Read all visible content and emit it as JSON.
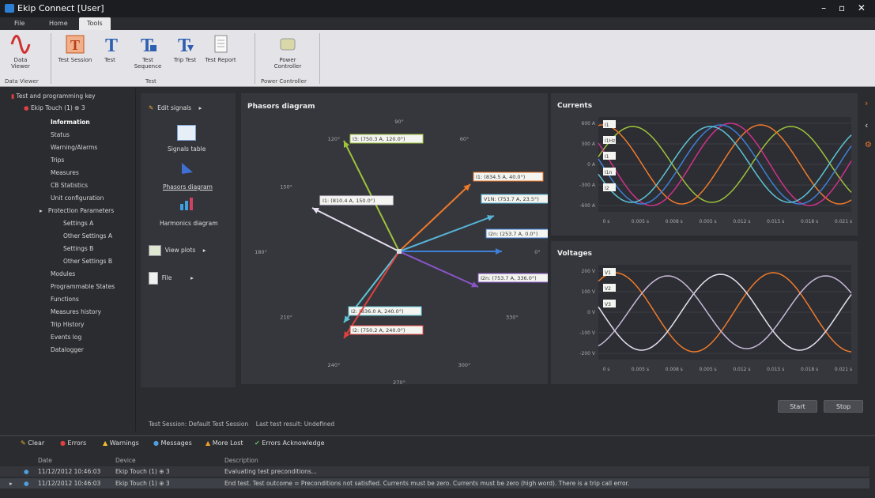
{
  "window": {
    "title": "Ekip Connect [User]",
    "controls": "– ▫ ✕"
  },
  "menu_tabs": [
    "File",
    "Home",
    "Tools"
  ],
  "ribbon": {
    "buttons": [
      {
        "label": "Data Viewer"
      },
      {
        "label": "Test Session"
      },
      {
        "label": "Test"
      },
      {
        "label": "Test Sequence"
      },
      {
        "label": "Trip Test"
      },
      {
        "label": "Test Report"
      },
      {
        "label": "Power Controller"
      }
    ],
    "groups": [
      "Data Viewer",
      "Test",
      "Power Controller"
    ]
  },
  "tree": {
    "root": "Test and programming key",
    "device": "Ekip Touch (1) ⊕ 3",
    "items": [
      "Information",
      "Status",
      "Warning/Alarms",
      "Trips",
      "Measures",
      "CB Statistics",
      "Unit configuration",
      "Protection Parameters",
      "Settings A",
      "Other Settings A",
      "Settings B",
      "Other Settings B",
      "Modules",
      "Programmable States",
      "Functions",
      "Measures history",
      "Trip History",
      "Events log",
      "Datalogger"
    ]
  },
  "tool_panel": {
    "edit_signals": "Edit signals",
    "signals_table": "Signals table",
    "phasors_diagram": "Phasors diagram",
    "harmonics_diagram": "Harmonics diagram",
    "view_plots": "View plots",
    "file": "File"
  },
  "phasor": {
    "title": "Phasors diagram",
    "angles": [
      "90°",
      "60°",
      "120°",
      "150°",
      "180°",
      "0°",
      "210°",
      "330°",
      "240°",
      "300°",
      "270°"
    ],
    "vectors": [
      {
        "label": "I3: (750.3 A, 120.0°)",
        "color": "#9fc23b"
      },
      {
        "label": "I1: (834.5 A, 40.0°)",
        "color": "#f07a2a"
      },
      {
        "label": "I1: (810.4 A, 150.0°)",
        "color": "#e8e0f0"
      },
      {
        "label": "V1N: (753.7 A, 23.5°)",
        "color": "#57b4d8"
      },
      {
        "label": "I2n: (253.7 A, 0.0°)",
        "color": "#3f7fd8"
      },
      {
        "label": "I2n: (753.7 A, 336.0°)",
        "color": "#8a55c8"
      },
      {
        "label": "I2: (836.0 A, 240.0°)",
        "color": "#5ec3d6"
      },
      {
        "label": "I2: (750.2 A, 240.0°)",
        "color": "#e0413f"
      }
    ]
  },
  "currents": {
    "title": "Currents",
    "yticks": [
      "600 A",
      "300 A",
      "0 A",
      "-300 A",
      "-600 A"
    ],
    "xticks": [
      "0 s",
      "0.005 s",
      "0.008 s",
      "0.005 s",
      "0.012 s",
      "0.015 s",
      "0.018 s",
      "0.021 s"
    ],
    "legend": [
      "I1",
      "I1Hz",
      "I1",
      "I1n",
      "I2"
    ]
  },
  "voltages": {
    "title": "Voltages",
    "yticks": [
      "200 V",
      "100 V",
      "0 V",
      "-100 V",
      "-200 V"
    ],
    "xticks": [
      "0 s",
      "0.005 s",
      "0.008 s",
      "0.005 s",
      "0.012 s",
      "0.015 s",
      "0.018 s",
      "0.021 s"
    ],
    "legend": [
      "V1",
      "V2",
      "V3"
    ]
  },
  "bottom": {
    "start": "Start",
    "stop": "Stop",
    "status": "Test Session: Default Test Session    Last test result: Undefined"
  },
  "log": {
    "tabs": [
      "Clear",
      "Errors",
      "Warnings",
      "Messages",
      "More Lost",
      "Errors Acknowledge"
    ],
    "headers": [
      "Date",
      "Device",
      "Description"
    ],
    "rows": [
      {
        "date": "11/12/2012 10:46:03",
        "device": "Ekip Touch (1) ⊕ 3",
        "desc": "Evaluating test preconditions..."
      },
      {
        "date": "11/12/2012 10:46:03",
        "device": "Ekip Touch (1) ⊕ 3",
        "desc": "End test. Test outcome = Preconditions not satisfied. Currents must be zero. Currents must be zero (high word). There is a trip call error."
      }
    ]
  },
  "colors": {
    "accent": "#f07a2a",
    "bg": "#2b2c30",
    "panel": "#35373d",
    "ribbon": "#e4e4e8"
  }
}
